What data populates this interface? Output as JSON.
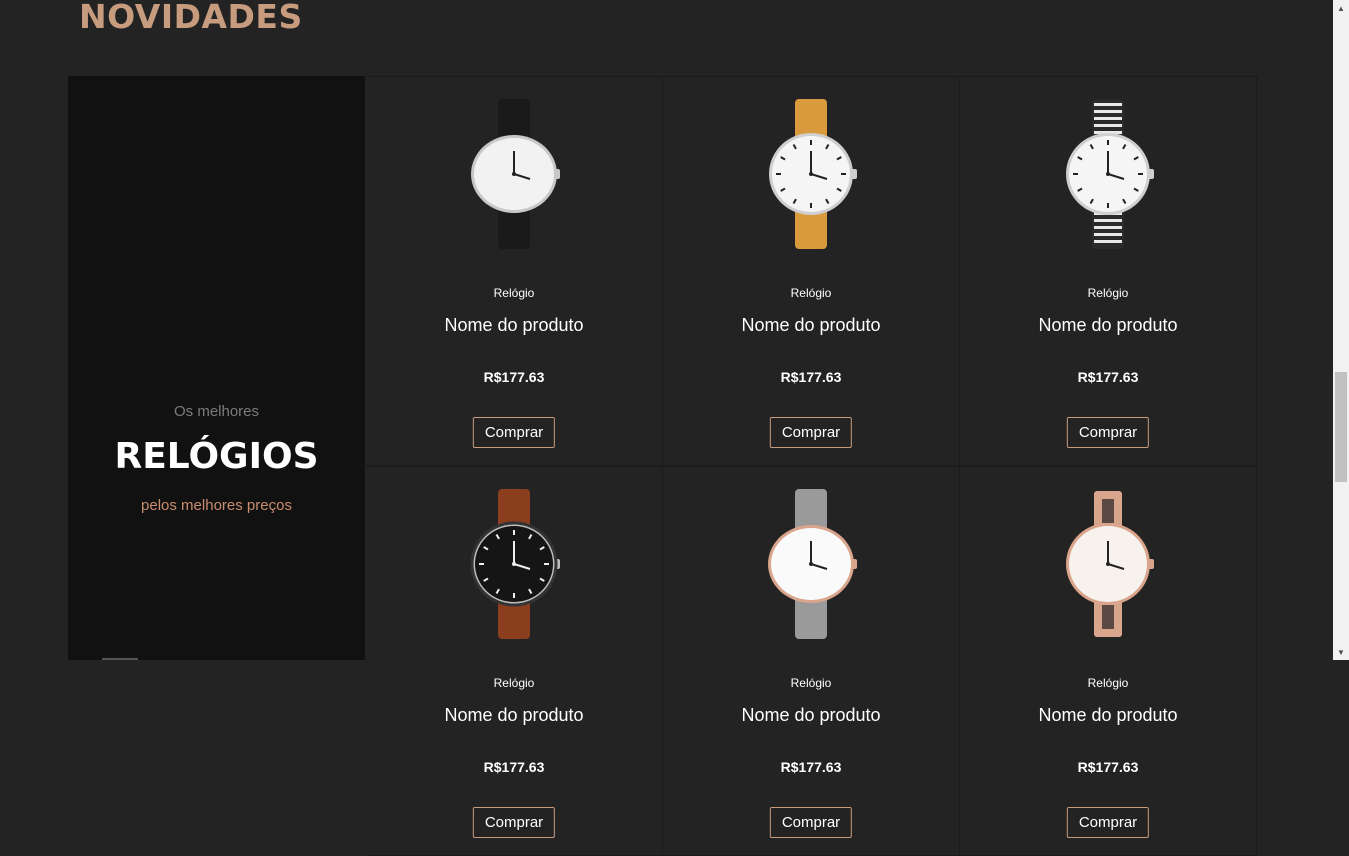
{
  "section": {
    "title": "NOVIDADES"
  },
  "promo": {
    "kicker": "Os melhores",
    "title": "RELÓGIOS",
    "subtitle": "pelos melhores preços"
  },
  "products": [
    {
      "category": "Relógio",
      "name": "Nome do produto",
      "price": "R$177.63",
      "button": "Comprar",
      "strap": "#1a1a1a",
      "face": "#f2f2f2",
      "case": "#c8c8c8",
      "style": "minimal"
    },
    {
      "category": "Relógio",
      "name": "Nome do produto",
      "price": "R$177.63",
      "button": "Comprar",
      "strap": "#d99a3d",
      "face": "#f5f5f5",
      "case": "#cfcfcf",
      "style": "roman"
    },
    {
      "category": "Relógio",
      "name": "Nome do produto",
      "price": "R$177.63",
      "button": "Comprar",
      "strap": "#2a2a2a",
      "face": "#f5f5f5",
      "case": "#cfcfcf",
      "style": "numbers"
    },
    {
      "category": "Relógio",
      "name": "Nome do produto",
      "price": "R$177.63",
      "button": "Comprar",
      "strap": "#8a3e1e",
      "face": "#151515",
      "case": "#bdbdbd",
      "style": "diver"
    },
    {
      "category": "Relógio",
      "name": "Nome do produto",
      "price": "R$177.63",
      "button": "Comprar",
      "strap": "#9a9a9a",
      "face": "#fafafa",
      "case": "#d9a58c",
      "style": "minimal"
    },
    {
      "category": "Relógio",
      "name": "Nome do produto",
      "price": "R$177.63",
      "button": "Comprar",
      "strap": "#d9a58c",
      "face": "#f7f2ee",
      "case": "#d9a58c",
      "style": "bracelet"
    }
  ],
  "colors": {
    "accent": "#c79b7e",
    "background": "#232323",
    "promo_bg": "#111111"
  }
}
